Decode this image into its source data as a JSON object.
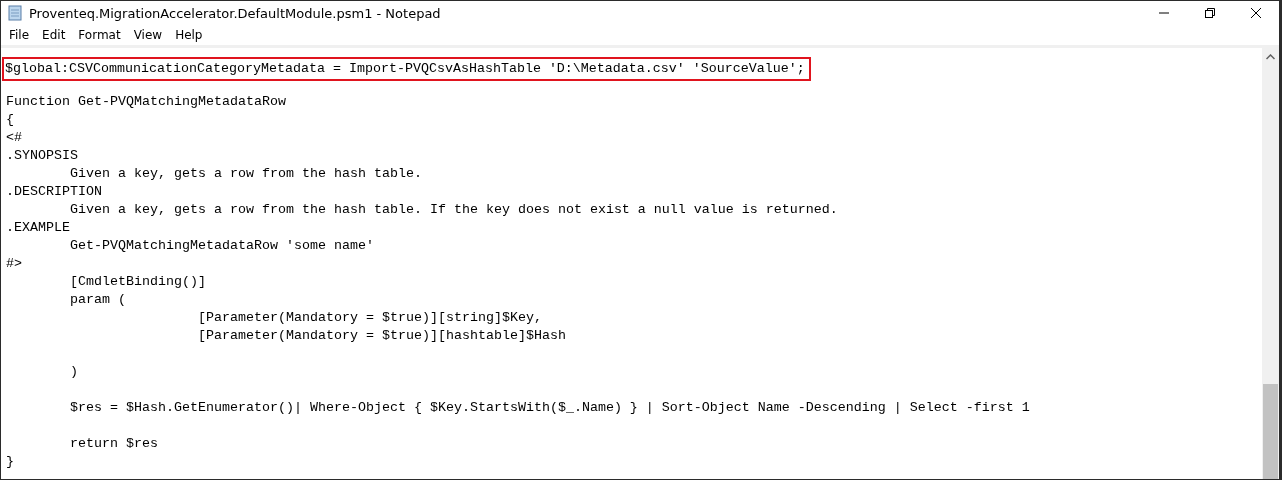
{
  "window": {
    "title": "Proventeq.MigrationAccelerator.DefaultModule.psm1 - Notepad"
  },
  "menu": [
    "File",
    "Edit",
    "Format",
    "View",
    "Help"
  ],
  "editor": {
    "blocks": [
      [
        {
          "text": "$global:CSVCommunicationCategoryMetadata = Import-PVQCsvAsHashTable 'D:\\Metadata.csv' 'SourceValue';",
          "highlighted": true
        }
      ],
      [
        {
          "text": "Function Get-PVQMatchingMetadataRow",
          "highlighted": false
        },
        {
          "text": "{",
          "highlighted": false
        },
        {
          "text": "<#",
          "highlighted": false
        },
        {
          "text": ".SYNOPSIS",
          "highlighted": false
        },
        {
          "text": "\tGiven a key, gets a row from the hash table.",
          "highlighted": false
        },
        {
          "text": ".DESCRIPTION",
          "highlighted": false
        },
        {
          "text": "\tGiven a key, gets a row from the hash table. If the key does not exist a null value is returned.",
          "highlighted": false
        },
        {
          "text": ".EXAMPLE",
          "highlighted": false
        },
        {
          "text": "\tGet-PVQMatchingMetadataRow 'some name'",
          "highlighted": false
        },
        {
          "text": "#>",
          "highlighted": false
        },
        {
          "text": "\t[CmdletBinding()]",
          "highlighted": false
        },
        {
          "text": "\tparam (",
          "highlighted": false
        },
        {
          "text": "\t\t\t[Parameter(Mandatory = $true)][string]$Key,",
          "highlighted": false
        },
        {
          "text": "\t\t\t[Parameter(Mandatory = $true)][hashtable]$Hash",
          "highlighted": false
        }
      ],
      [
        {
          "text": "\t)",
          "highlighted": false
        }
      ],
      [
        {
          "text": "\t$res = $Hash.GetEnumerator()| Where-Object { $Key.StartsWith($_.Name) } | Sort-Object Name -Descending | Select -first 1",
          "highlighted": false
        }
      ],
      [
        {
          "text": "\treturn $res",
          "highlighted": false
        },
        {
          "text": "}",
          "highlighted": false
        }
      ]
    ]
  }
}
